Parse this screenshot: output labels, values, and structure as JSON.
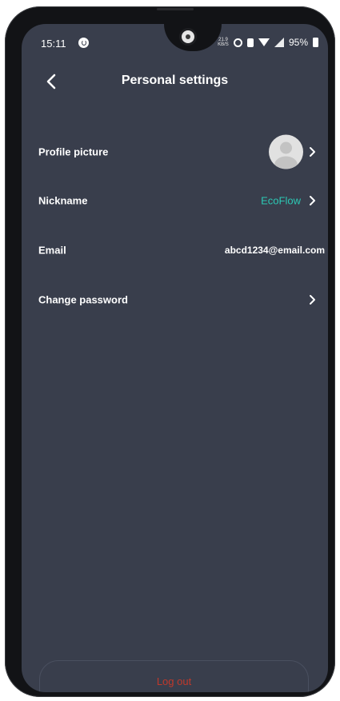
{
  "status_bar": {
    "time": "15:11",
    "net_speed_top": "21.9",
    "net_speed_bottom": "KB/S",
    "battery": "95%"
  },
  "header": {
    "title": "Personal settings"
  },
  "settings": {
    "profile_picture_label": "Profile picture",
    "nickname_label": "Nickname",
    "nickname_value": "EcoFlow",
    "email_label": "Email",
    "email_value": "abcd1234@email.com",
    "change_password_label": "Change password"
  },
  "footer": {
    "logout_label": "Log out"
  },
  "colors": {
    "background": "#393e4c",
    "accent": "#2cc9b5",
    "danger": "#c0392b",
    "text": "#ffffff"
  },
  "icons": {
    "back": "chevron-left-icon",
    "row_arrow": "chevron-right-icon",
    "avatar": "default-avatar-icon"
  }
}
